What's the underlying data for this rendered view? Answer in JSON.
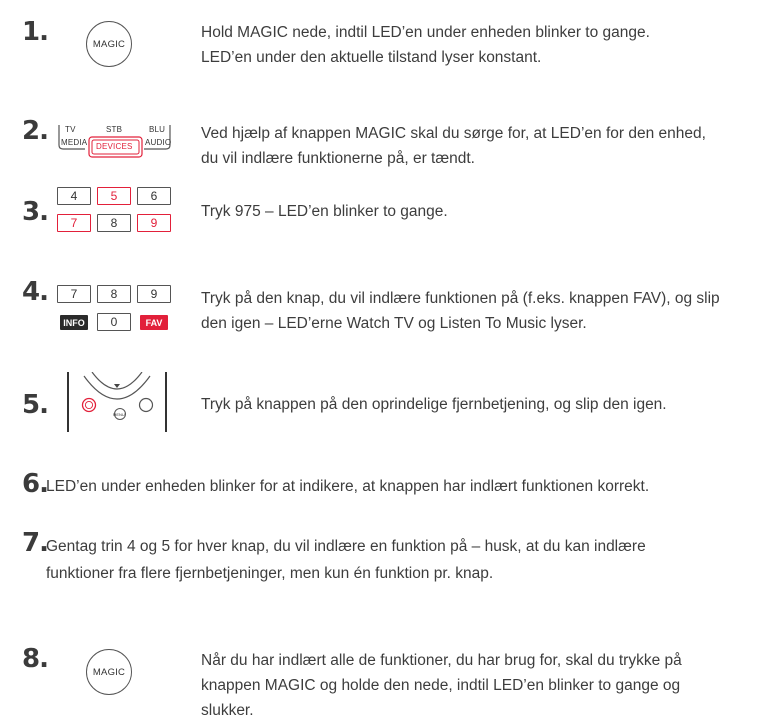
{
  "steps": [
    {
      "number": "1.",
      "text_line1": "Hold MAGIC nede, indtil LED’en under enheden blinker to gange.",
      "text_line2": "LED’en under den aktuelle tilstand  lyser konstant."
    },
    {
      "number": "2.",
      "text_line1": "Ved hjælp af knappen MAGIC skal du sørge for, at LED’en for den enhed,",
      "text_line2": "du vil indlære funktionerne på, er tændt."
    },
    {
      "number": "3.",
      "text": "Tryk 975 – LED’en blinker to gange."
    },
    {
      "number": "4.",
      "text_line1": "Tryk på den knap, du vil indlære funktionen på (f.eks. knappen FAV), og slip",
      "text_line2": "den igen – LED’erne Watch TV og Listen To Music lyser."
    },
    {
      "number": "5.",
      "text": "Tryk på knappen på den oprindelige fjernbetjening, og slip den igen."
    },
    {
      "number": "6.",
      "text": "LED’en under enheden blinker for at indikere, at knappen har indlært funktionen korrekt."
    },
    {
      "number": "7.",
      "text_line1": "Gentag trin 4 og 5 for hver knap, du vil indlære en funktion på – husk, at du kan indlære",
      "text_line2": "funktioner fra flere fjernbetjeninger, men kun én funktion pr. knap."
    },
    {
      "number": "8.",
      "text_line1": "Når du har indlært alle de funktioner, du har brug for, skal du trykke på",
      "text_line2": "knappen MAGIC og holde den nede, indtil LED’en blinker to gange og",
      "text_line3": "slukker."
    }
  ],
  "illustrations": {
    "magic_label": "MAGIC",
    "device_selector": {
      "tv": "TV",
      "stb": "STB",
      "blu": "BLU",
      "media": "MEDIA",
      "devices": "DEVICES",
      "audio": "AUDIO"
    },
    "keypad_step3": [
      "4",
      "5",
      "6",
      "7",
      "8",
      "9"
    ],
    "keypad_step4": [
      "7",
      "8",
      "9",
      "INFO",
      "0",
      "FAV"
    ],
    "remote_menu_label": "MENU"
  },
  "colors": {
    "accent_red": "#e2203a",
    "text": "#3d3d3d"
  }
}
